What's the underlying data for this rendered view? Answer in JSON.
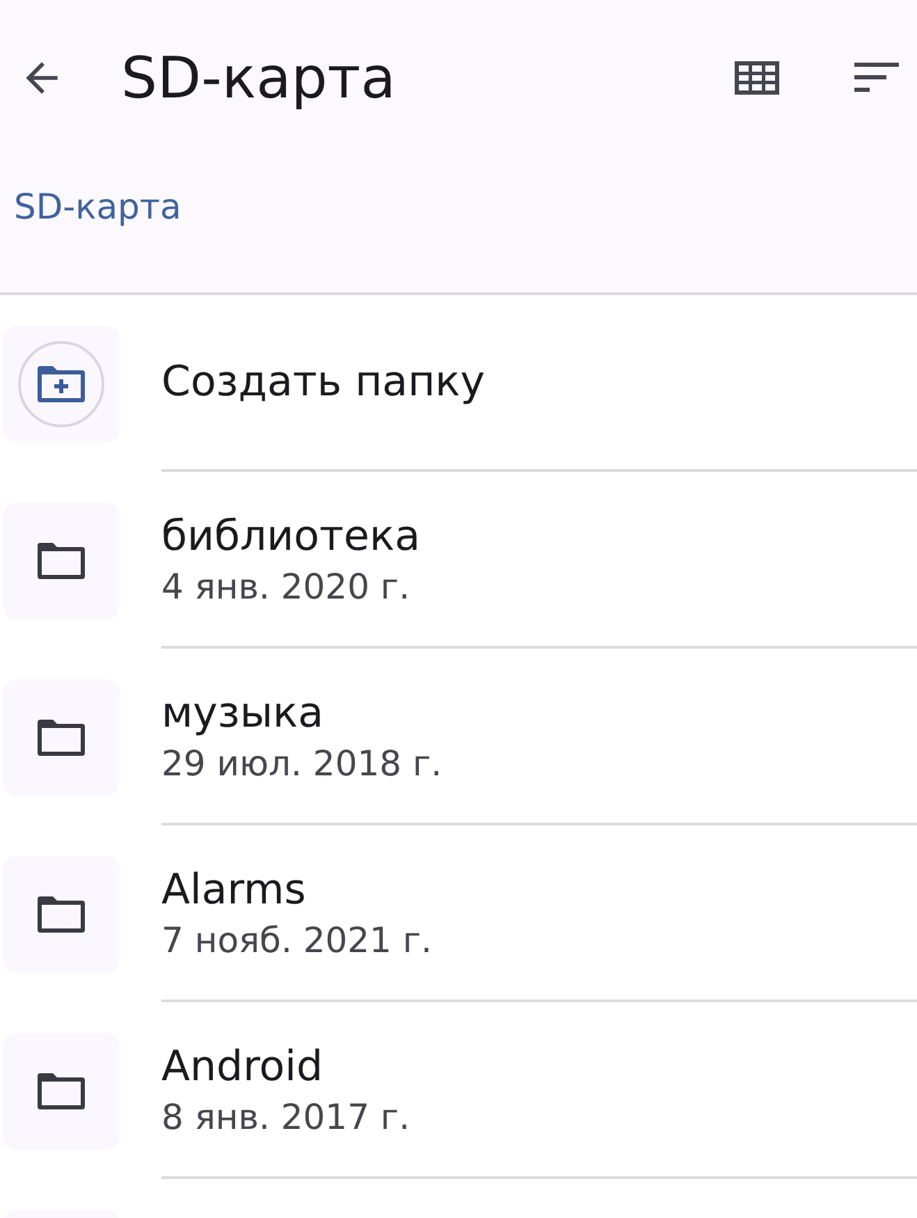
{
  "header": {
    "title": "SD-карта"
  },
  "breadcrumb": "SD-карта",
  "create_folder": {
    "label": "Создать папку"
  },
  "items": [
    {
      "name": "библиотека",
      "date": "4 янв. 2020 г."
    },
    {
      "name": "музыка",
      "date": "29 июл. 2018 г."
    },
    {
      "name": "Alarms",
      "date": "7 нояб. 2021 г."
    },
    {
      "name": "Android",
      "date": "8 янв. 2017 г."
    }
  ]
}
